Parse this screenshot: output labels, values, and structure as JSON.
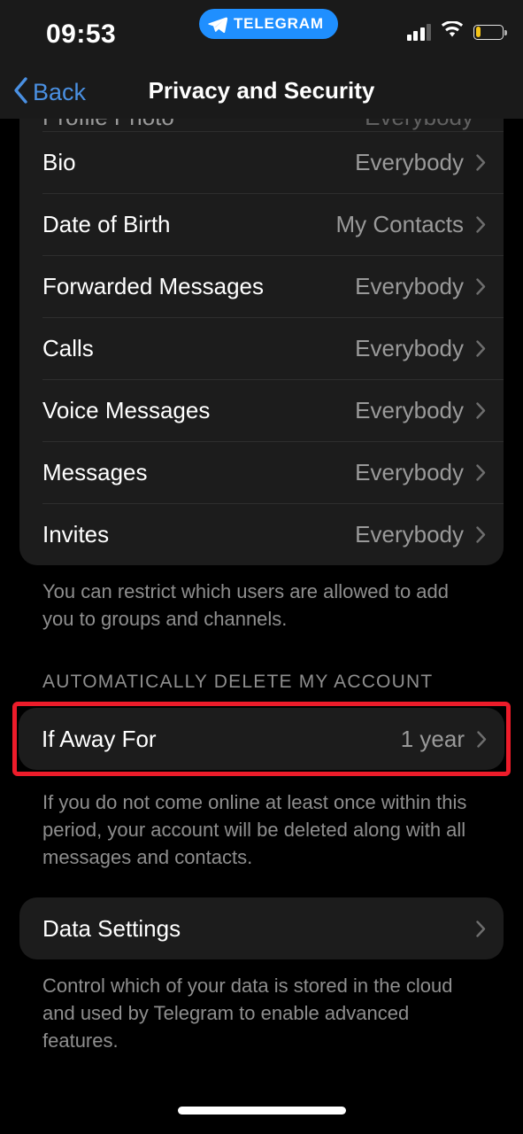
{
  "status_bar": {
    "time": "09:53",
    "app_badge": "TELEGRAM",
    "signal_icon": "signal-bars-icon",
    "wifi_icon": "wifi-icon",
    "battery_icon": "battery-low-icon",
    "battery_color": "#f5c518"
  },
  "nav": {
    "back_label": "Back",
    "back_icon": "chevron-left-icon",
    "title": "Privacy and Security",
    "accent_color": "#4a90e2"
  },
  "privacy_section": {
    "cut_row": {
      "label": "Profile Photo",
      "value": "Everybody"
    },
    "rows": [
      {
        "label": "Bio",
        "value": "Everybody"
      },
      {
        "label": "Date of Birth",
        "value": "My Contacts"
      },
      {
        "label": "Forwarded Messages",
        "value": "Everybody"
      },
      {
        "label": "Calls",
        "value": "Everybody"
      },
      {
        "label": "Voice Messages",
        "value": "Everybody"
      },
      {
        "label": "Messages",
        "value": "Everybody"
      },
      {
        "label": "Invites",
        "value": "Everybody"
      }
    ],
    "footer": "You can restrict which users are allowed to add you to groups and channels."
  },
  "auto_delete_section": {
    "header": "AUTOMATICALLY DELETE MY ACCOUNT",
    "row": {
      "label": "If Away For",
      "value": "1 year"
    },
    "footer": "If you do not come online at least once within this period, your account will be deleted along with all messages and contacts.",
    "highlight_color": "#ed1c2a"
  },
  "data_section": {
    "row": {
      "label": "Data Settings",
      "value": ""
    },
    "footer": "Control which of your data is stored in the cloud and used by Telegram to enable advanced features."
  }
}
